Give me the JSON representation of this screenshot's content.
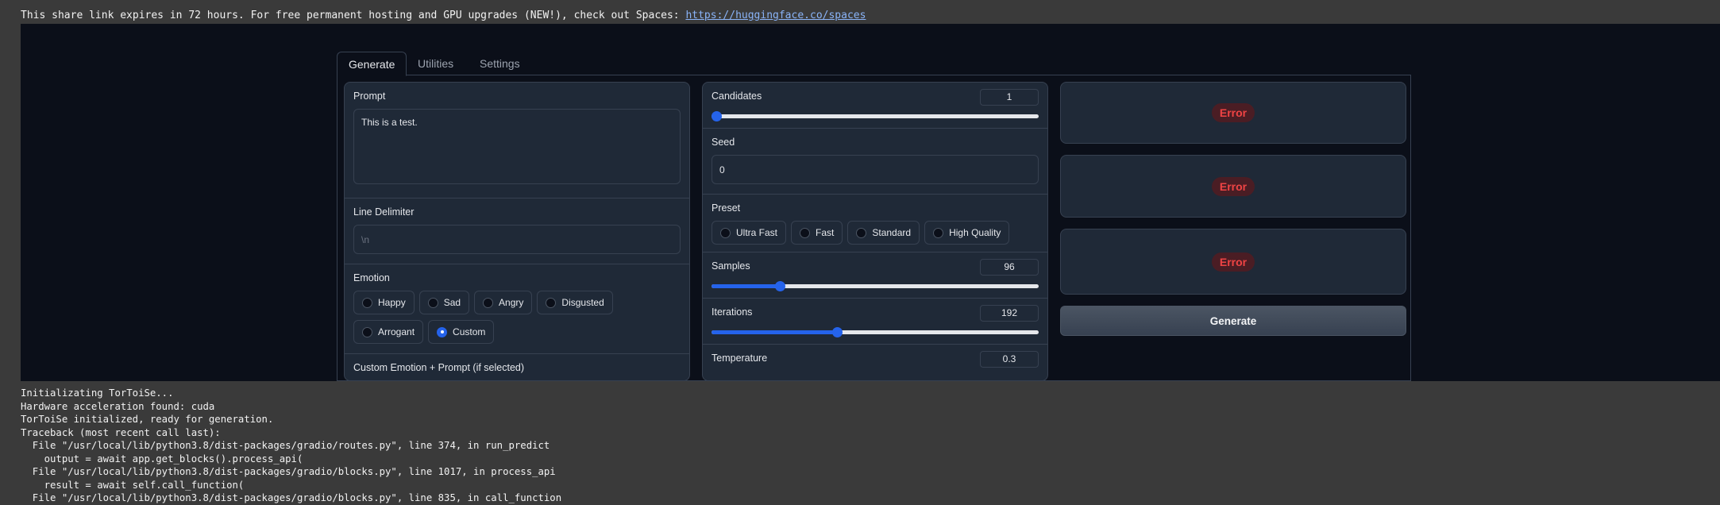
{
  "notice": {
    "text": "This share link expires in 72 hours. For free permanent hosting and GPU upgrades (NEW!), check out Spaces: ",
    "link": "https://huggingface.co/spaces"
  },
  "tabs": [
    {
      "label": "Generate",
      "active": true
    },
    {
      "label": "Utilities",
      "active": false
    },
    {
      "label": "Settings",
      "active": false
    }
  ],
  "left": {
    "prompt_label": "Prompt",
    "prompt_value": "This is a test.",
    "delimiter_label": "Line Delimiter",
    "delimiter_placeholder": "\\n",
    "emotion_label": "Emotion",
    "emotions": [
      "Happy",
      "Sad",
      "Angry",
      "Disgusted",
      "Arrogant",
      "Custom"
    ],
    "emotion_selected": "Custom",
    "custom_label": "Custom Emotion + Prompt (if selected)"
  },
  "mid": {
    "candidates_label": "Candidates",
    "candidates_value": "1",
    "candidates_fraction": 0.0,
    "seed_label": "Seed",
    "seed_value": "0",
    "preset_label": "Preset",
    "presets": [
      "Ultra Fast",
      "Fast",
      "Standard",
      "High Quality"
    ],
    "samples_label": "Samples",
    "samples_value": "96",
    "samples_fraction": 0.2,
    "iterations_label": "Iterations",
    "iterations_value": "192",
    "iterations_fraction": 0.38,
    "temperature_label": "Temperature",
    "temperature_value": "0.3"
  },
  "right": {
    "error_label": "Error",
    "generate_label": "Generate"
  },
  "console": [
    "Initializating TorToiSe...",
    "Hardware acceleration found: cuda",
    "TorToiSe initialized, ready for generation.",
    "Traceback (most recent call last):",
    "  File \"/usr/local/lib/python3.8/dist-packages/gradio/routes.py\", line 374, in run_predict",
    "    output = await app.get_blocks().process_api(",
    "  File \"/usr/local/lib/python3.8/dist-packages/gradio/blocks.py\", line 1017, in process_api",
    "    result = await self.call_function(",
    "  File \"/usr/local/lib/python3.8/dist-packages/gradio/blocks.py\", line 835, in call_function"
  ],
  "colors": {
    "accent": "#2563eb",
    "error": "#ef4444",
    "app_bg": "#0b0f19",
    "panel_bg": "#1f2937"
  }
}
